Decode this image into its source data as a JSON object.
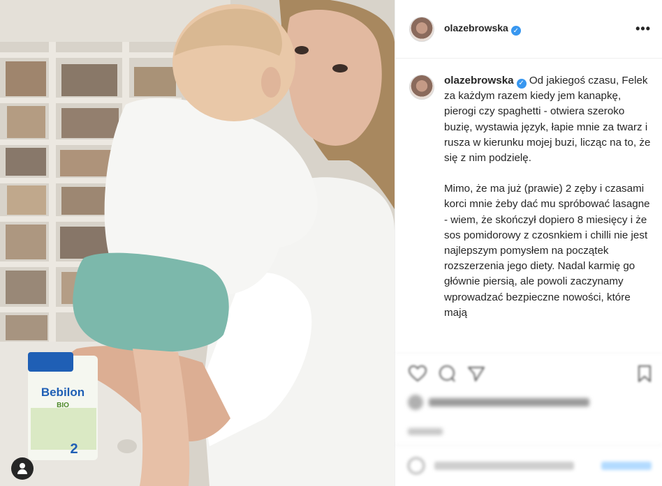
{
  "photo": {
    "product_brand": "Bebilon",
    "product_sub": "BIO",
    "product_stage": "2"
  },
  "header": {
    "username": "olazebrowska",
    "verified_icon": "verified-badge-icon",
    "more_icon": "more-options-icon",
    "more_label": "•••"
  },
  "caption": {
    "username": "olazebrowska",
    "paragraph_1": "Od jakiegoś czasu, Felek za każdym razem kiedy jem kanapkę, pierogi czy spaghetti - otwiera szeroko buzię, wystawia język, łapie mnie za twarz i rusza w kierunku mojej buzi, licząc na to, że się z nim podzielę.",
    "paragraph_2": "Mimo, że ma już (prawie) 2 zęby i czasami korci mnie żeby dać mu spróbować lasagne - wiem, że skończył dopiero 8 miesięcy i że sos pomidorowy z czosnkiem i chilli nie jest najlepszym pomysłem na początek rozszerzenia jego diety. Nadal karmię go głównie piersią, ale powoli zaczynamy wprowadzać bezpieczne nowości, które mają"
  },
  "actions": {
    "icons": [
      "heart-icon",
      "comment-icon",
      "share-icon",
      "bookmark-icon"
    ]
  },
  "colors": {
    "verified": "#3897f0",
    "border": "#efefef",
    "text": "#262626"
  }
}
